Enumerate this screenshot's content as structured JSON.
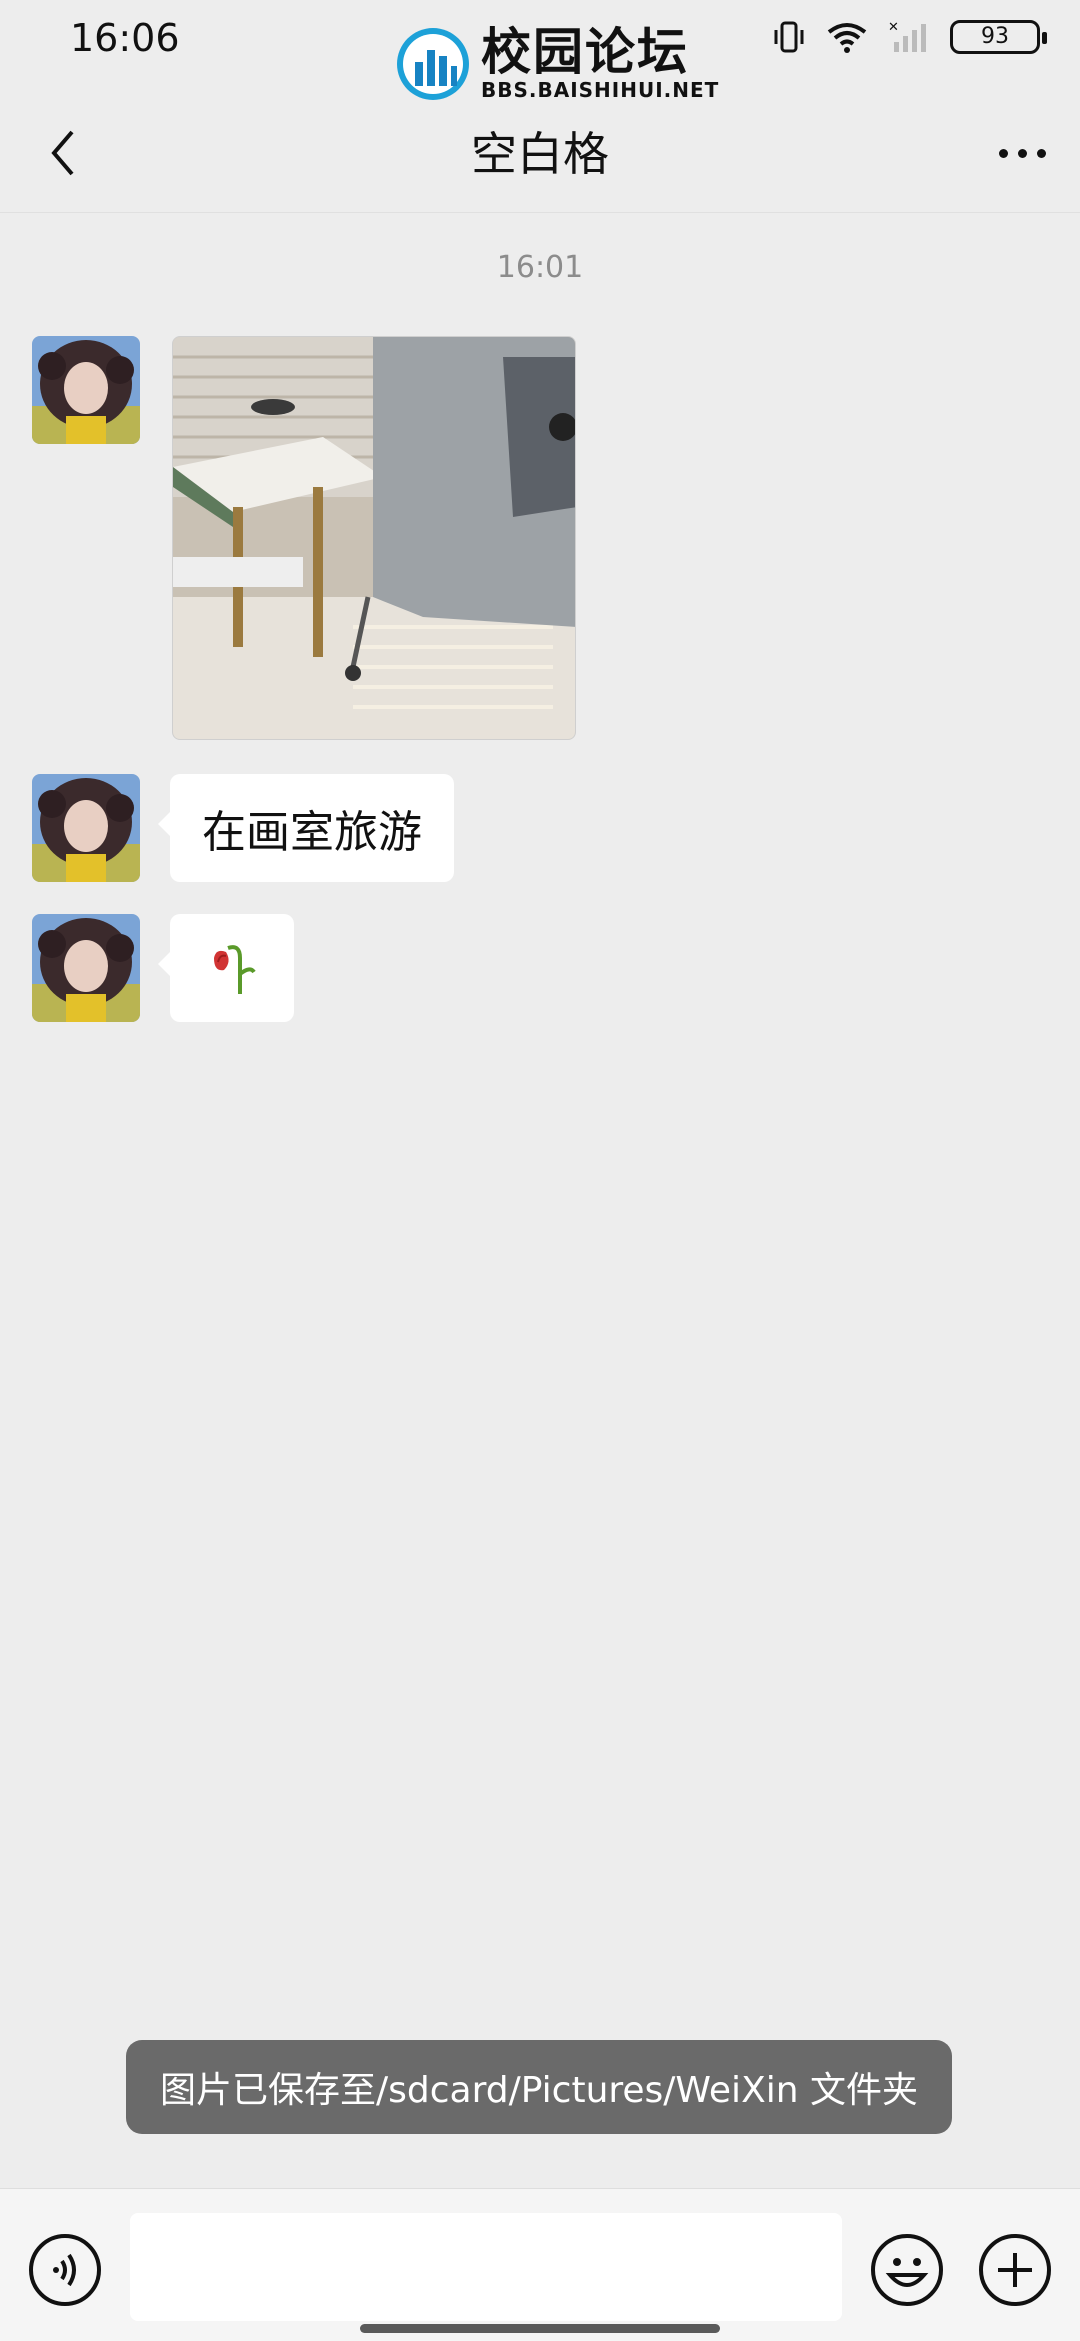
{
  "status_bar": {
    "time": "16:06",
    "battery": "93",
    "icons": [
      "vibrate-icon",
      "wifi-icon",
      "signal-icon",
      "battery-icon"
    ]
  },
  "watermark": {
    "title": "校园论坛",
    "subtitle": "BBS.BAISHIHUI.NET"
  },
  "header": {
    "title": "空白格",
    "back_icon": "chevron-left-icon",
    "more_icon": "more-icon"
  },
  "chat": {
    "timestamp": "16:01",
    "messages": [
      {
        "type": "image",
        "content": "photo of a drawing studio"
      },
      {
        "type": "text",
        "text": "在画室旅游"
      },
      {
        "type": "emoji",
        "text": "🥀"
      }
    ]
  },
  "toast": {
    "text": "图片已保存至/sdcard/Pictures/WeiXin 文件夹"
  },
  "input_bar": {
    "voice_icon": "voice-icon",
    "emoji_icon": "emoji-icon",
    "plus_icon": "plus-icon"
  },
  "colors": {
    "background": "#ededed",
    "bubble": "#ffffff",
    "toast": "#6a6a6a"
  }
}
